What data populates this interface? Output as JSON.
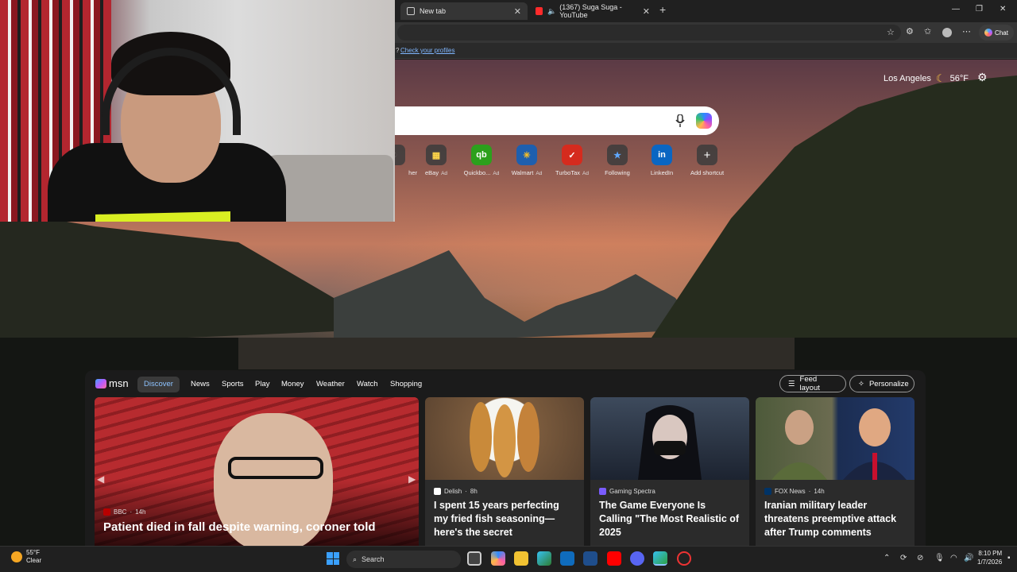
{
  "browser": {
    "tabs": [
      {
        "title": "New tab",
        "active": true
      },
      {
        "title": "(1367) Suga Suga - YouTube",
        "active": false
      }
    ],
    "chat_label": "Chat",
    "info_link": "Check your profiles",
    "info_prefix": "?"
  },
  "newtab": {
    "weather": {
      "city": "Los Angeles",
      "temp": "56°F"
    },
    "shortcuts": [
      {
        "label": "her",
        "ad": ""
      },
      {
        "label": "eBay",
        "ad": "Ad"
      },
      {
        "label": "Quickbo...",
        "ad": "Ad"
      },
      {
        "label": "Walmart",
        "ad": "Ad"
      },
      {
        "label": "TurboTax",
        "ad": "Ad"
      },
      {
        "label": "Following",
        "ad": ""
      },
      {
        "label": "LinkedIn",
        "ad": ""
      },
      {
        "label": "Add shortcut",
        "ad": ""
      }
    ]
  },
  "msn": {
    "logo": "msn",
    "nav": [
      "Discover",
      "News",
      "Sports",
      "Play",
      "Money",
      "Weather",
      "Watch",
      "Shopping"
    ],
    "feed_layout": "Feed layout",
    "personalize": "Personalize",
    "cards": [
      {
        "source": "BBC",
        "age": "14h",
        "headline": "Patient died in fall despite warning, coroner told"
      },
      {
        "source": "Delish",
        "age": "8h",
        "headline": "I spent 15 years perfecting my fried fish seasoning—here's the secret"
      },
      {
        "source": "Gaming Spectra",
        "age": "",
        "headline": "The Game Everyone Is Calling \"The Most Realistic of 2025"
      },
      {
        "source": "FOX News",
        "age": "14h",
        "headline": "Iranian military leader threatens preemptive attack after Trump comments"
      }
    ]
  },
  "taskbar": {
    "weather_temp": "55°F",
    "weather_cond": "Clear",
    "search_placeholder": "Search",
    "time": "8:10 PM",
    "date": "1/7/2026"
  },
  "colors": {
    "accent": "#8ec3ff",
    "link": "#7fb6ff"
  }
}
